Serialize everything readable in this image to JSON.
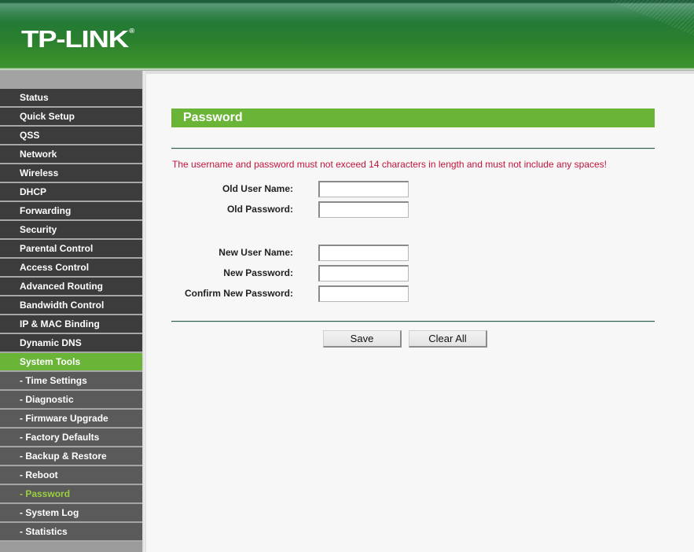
{
  "header": {
    "logo_text": "TP-LINK",
    "logo_mark": "®"
  },
  "sidebar": {
    "items": [
      {
        "label": "Status",
        "type": "main"
      },
      {
        "label": "Quick Setup",
        "type": "main"
      },
      {
        "label": "QSS",
        "type": "main"
      },
      {
        "label": "Network",
        "type": "main"
      },
      {
        "label": "Wireless",
        "type": "main"
      },
      {
        "label": "DHCP",
        "type": "main"
      },
      {
        "label": "Forwarding",
        "type": "main"
      },
      {
        "label": "Security",
        "type": "main"
      },
      {
        "label": "Parental Control",
        "type": "main"
      },
      {
        "label": "Access Control",
        "type": "main"
      },
      {
        "label": "Advanced Routing",
        "type": "main"
      },
      {
        "label": "Bandwidth Control",
        "type": "main"
      },
      {
        "label": "IP & MAC Binding",
        "type": "main"
      },
      {
        "label": "Dynamic DNS",
        "type": "main"
      },
      {
        "label": "System Tools",
        "type": "main",
        "active": true
      },
      {
        "label": "- Time Settings",
        "type": "sub"
      },
      {
        "label": "- Diagnostic",
        "type": "sub"
      },
      {
        "label": "- Firmware Upgrade",
        "type": "sub"
      },
      {
        "label": "- Factory Defaults",
        "type": "sub"
      },
      {
        "label": "- Backup & Restore",
        "type": "sub"
      },
      {
        "label": "- Reboot",
        "type": "sub"
      },
      {
        "label": "- Password",
        "type": "sub",
        "current": true
      },
      {
        "label": "- System Log",
        "type": "sub"
      },
      {
        "label": "- Statistics",
        "type": "sub"
      }
    ]
  },
  "main": {
    "title": "Password",
    "warning": "The username and password must not exceed 14 characters in length and must not include any spaces!",
    "fields": {
      "old_user_name": {
        "label": "Old User Name:",
        "value": ""
      },
      "old_password": {
        "label": "Old Password:",
        "value": ""
      },
      "new_user_name": {
        "label": "New User Name:",
        "value": ""
      },
      "new_password": {
        "label": "New Password:",
        "value": ""
      },
      "confirm_new_password": {
        "label": "Confirm New Password:",
        "value": ""
      }
    },
    "buttons": {
      "save": "Save",
      "clear_all": "Clear All"
    }
  },
  "colors": {
    "accent_green": "#6ab537",
    "warning_red": "#c0143c",
    "nav_dark": "#3c3c3c",
    "nav_sub": "#5a5a5a"
  }
}
